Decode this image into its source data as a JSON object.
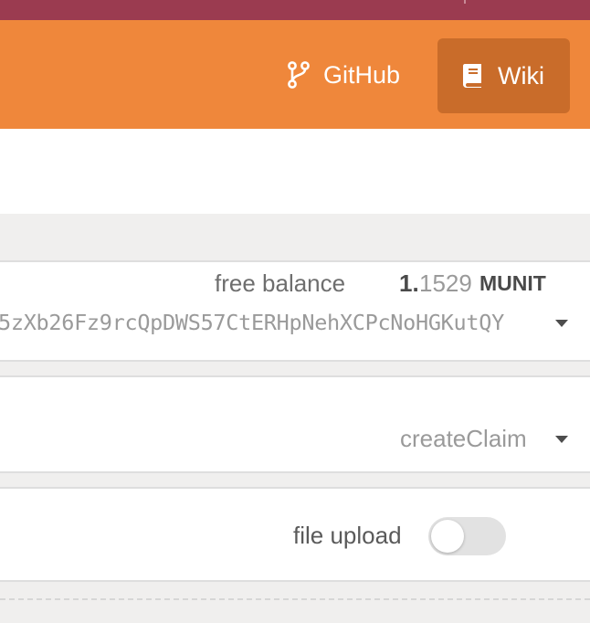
{
  "header": {
    "nav": {
      "github_label": "GitHub",
      "wiki_label": "Wiki",
      "github_icon": "code-branch-icon",
      "wiki_icon": "book-icon"
    }
  },
  "account": {
    "balance_label": "free balance",
    "balance_integer": "1.",
    "balance_decimal": "1529",
    "balance_unit": "MUNIT",
    "address": "5zXb26Fz9rcQpDWS57CtERHpNehXCPcNoHGKutQY"
  },
  "method": {
    "selected": "createClaim"
  },
  "upload": {
    "label": "file upload",
    "toggle_on": false
  },
  "colors": {
    "navbar": "#ef873b",
    "wiki_active": "#c96c2a",
    "top_strip": "#9b3b50"
  }
}
